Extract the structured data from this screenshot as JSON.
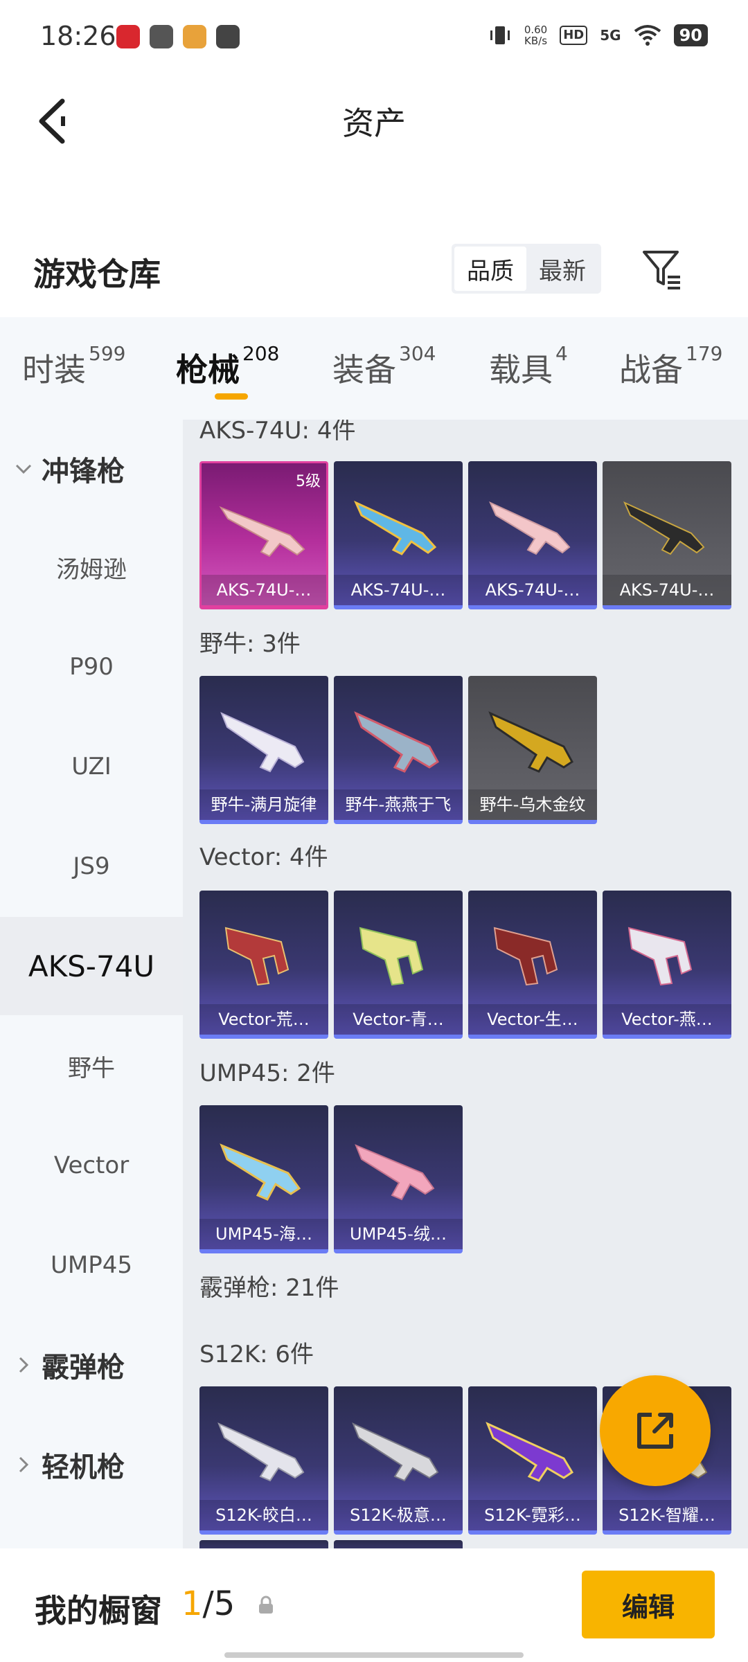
{
  "status_bar": {
    "time": "18:26",
    "net_speed_value": "0.60",
    "net_speed_unit": "KB/s",
    "hd": "HD",
    "signal": "5G",
    "battery": "90",
    "icons": [
      "vibrate-icon",
      "hd-icon",
      "signal-5g-icon",
      "wifi-icon",
      "battery-icon"
    ]
  },
  "header": {
    "title": "资产",
    "back_icon": "back-arrow-icon"
  },
  "warehouse": {
    "title": "游戏仓库",
    "sort_options": [
      "品质",
      "最新"
    ],
    "active_sort": "品质",
    "filter_icon": "filter-icon"
  },
  "tabs": [
    {
      "label": "时装",
      "count": "599"
    },
    {
      "label": "枪械",
      "count": "208",
      "active": true
    },
    {
      "label": "装备",
      "count": "304"
    },
    {
      "label": "载具",
      "count": "4"
    },
    {
      "label": "战备",
      "count": "179"
    }
  ],
  "sidebar": {
    "items": [
      {
        "label": "冲锋枪",
        "type": "group",
        "expanded": true
      },
      {
        "label": "汤姆逊"
      },
      {
        "label": "P90"
      },
      {
        "label": "UZI"
      },
      {
        "label": "JS9"
      },
      {
        "label": "AKS-74U",
        "active": true
      },
      {
        "label": "野牛"
      },
      {
        "label": "Vector"
      },
      {
        "label": "UMP45"
      },
      {
        "label": "霰弹枪",
        "type": "group",
        "expanded": false
      },
      {
        "label": "轻机枪",
        "type": "group",
        "expanded": false
      }
    ]
  },
  "sections": [
    {
      "title": "AKS-74U: 4件",
      "items": [
        {
          "name": "AKS-74U-…",
          "rarity": "gold",
          "level": "5级"
        },
        {
          "name": "AKS-74U-…",
          "rarity": "purple"
        },
        {
          "name": "AKS-74U-…",
          "rarity": "purple"
        },
        {
          "name": "AKS-74U-…",
          "rarity": "grey"
        }
      ]
    },
    {
      "title": "野牛: 3件",
      "items": [
        {
          "name": "野牛-满月旋律",
          "rarity": "purple"
        },
        {
          "name": "野牛-燕燕于飞",
          "rarity": "purple"
        },
        {
          "name": "野牛-乌木金纹",
          "rarity": "grey"
        }
      ]
    },
    {
      "title": "Vector: 4件",
      "items": [
        {
          "name": "Vector-荒…",
          "rarity": "purple"
        },
        {
          "name": "Vector-青…",
          "rarity": "purple"
        },
        {
          "name": "Vector-生…",
          "rarity": "purple"
        },
        {
          "name": "Vector-燕…",
          "rarity": "purple"
        }
      ]
    },
    {
      "title": "UMP45: 2件",
      "items": [
        {
          "name": "UMP45-海…",
          "rarity": "purple"
        },
        {
          "name": "UMP45-绒…",
          "rarity": "purple"
        }
      ]
    },
    {
      "title": "霰弹枪: 21件",
      "items": []
    },
    {
      "title": "S12K: 6件",
      "items": [
        {
          "name": "S12K-皎白…",
          "rarity": "purple"
        },
        {
          "name": "S12K-极意…",
          "rarity": "purple"
        },
        {
          "name": "S12K-霓彩…",
          "rarity": "purple"
        },
        {
          "name": "S12K-智耀…",
          "rarity": "purple"
        }
      ]
    }
  ],
  "fab_icon": "share-export-icon",
  "bottom": {
    "showcase_label": "我的橱窗",
    "showcase_current": "1",
    "showcase_total": "/5",
    "lock_icon": "lock-icon",
    "edit_label": "编辑"
  }
}
